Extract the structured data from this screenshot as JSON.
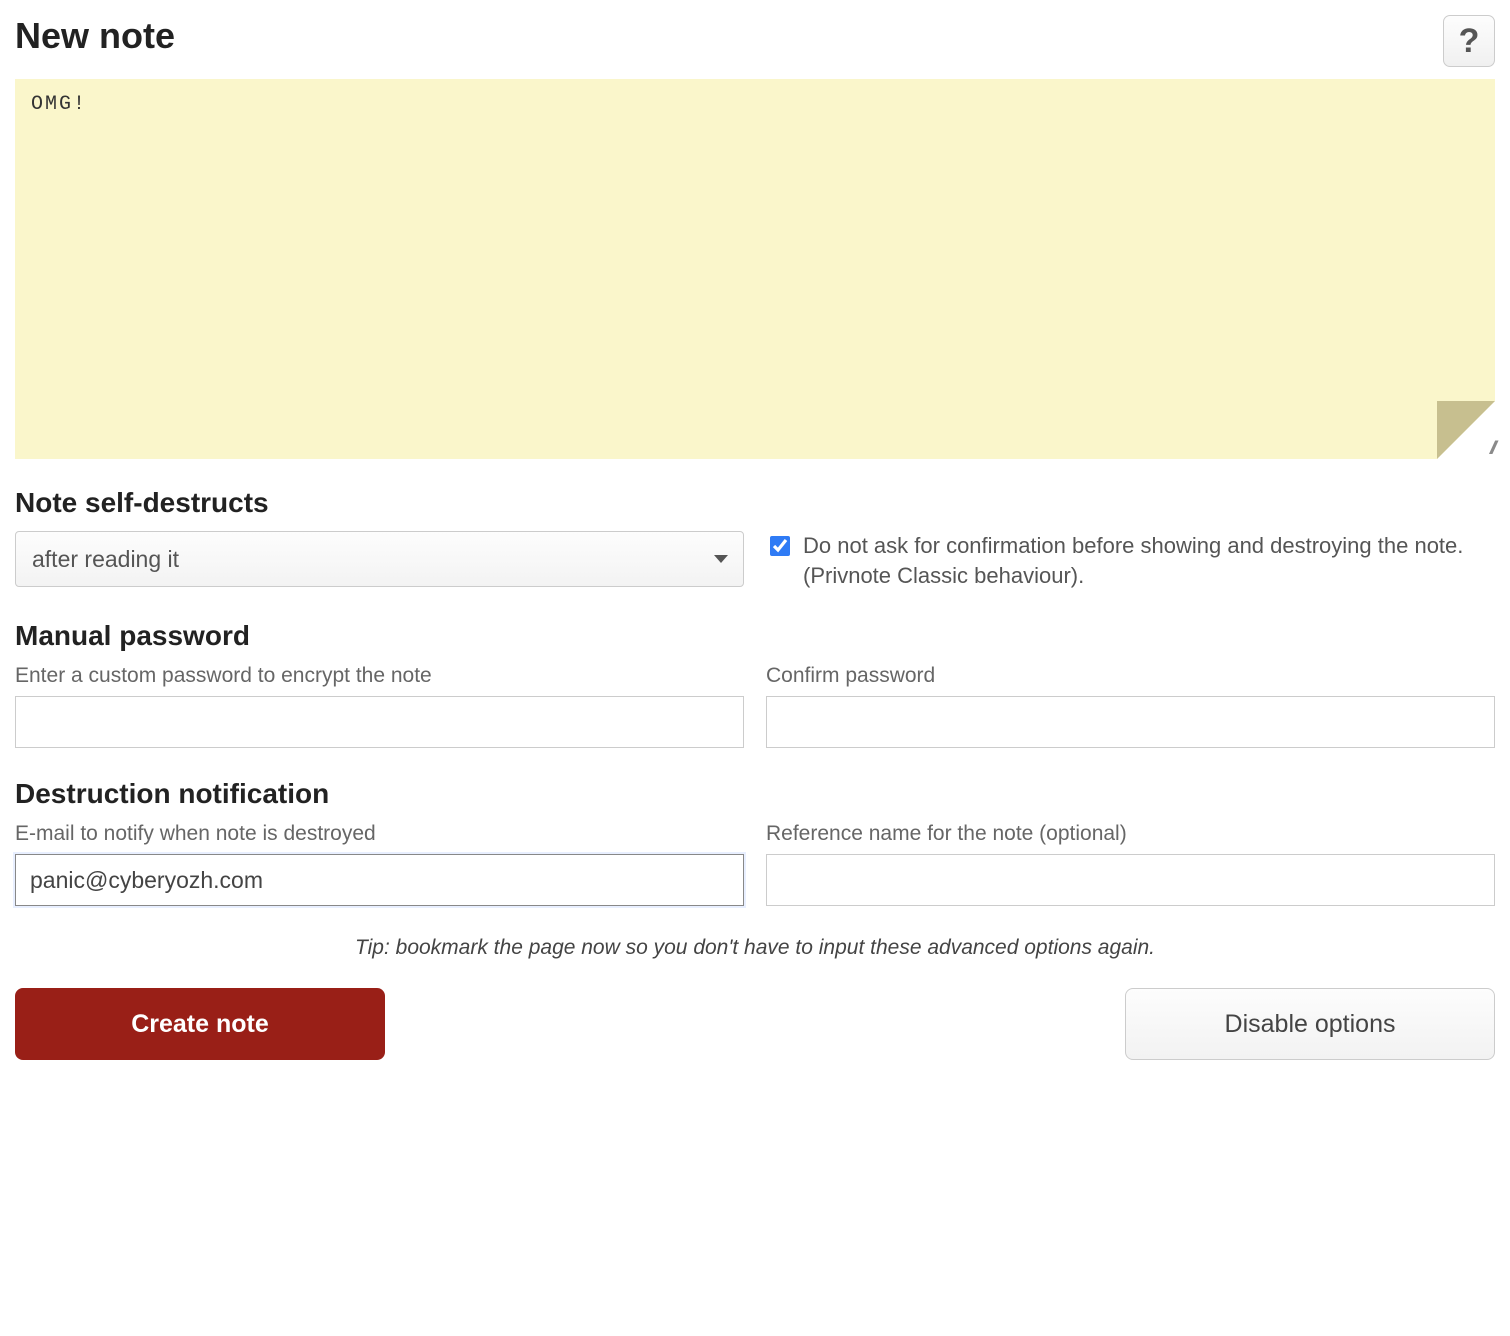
{
  "header": {
    "title": "New note",
    "help": "?"
  },
  "note": {
    "content": "OMG!"
  },
  "self_destruct": {
    "heading": "Note self-destructs",
    "selected": "after reading it",
    "no_confirm_checked": true,
    "no_confirm_label": "Do not ask for confirmation before showing and destroying the note. (Privnote Classic behaviour)."
  },
  "manual_password": {
    "heading": "Manual password",
    "password_label": "Enter a custom password to encrypt the note",
    "password_value": "",
    "confirm_label": "Confirm password",
    "confirm_value": ""
  },
  "destruction_notification": {
    "heading": "Destruction notification",
    "email_label": "E-mail to notify when note is destroyed",
    "email_value": "panic@cyberyozh.com",
    "refname_label": "Reference name for the note (optional)",
    "refname_value": ""
  },
  "tip": "Tip: bookmark the page now so you don't have to input these advanced options again.",
  "buttons": {
    "create": "Create note",
    "disable_options": "Disable options"
  }
}
